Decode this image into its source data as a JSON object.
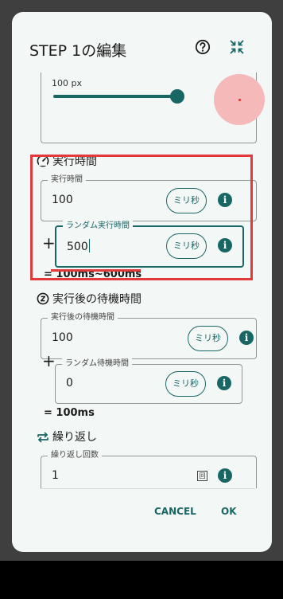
{
  "dialog": {
    "title": "STEP 1の編集",
    "help_icon": "help-circle-icon",
    "collapse_icon": "collapse-arrows-icon"
  },
  "size_slider": {
    "value_label": "100 px",
    "value_fraction": 0.92
  },
  "execution_time": {
    "section_title": "実行時間",
    "section_icon": "speedometer-icon",
    "field_label": "実行時間",
    "value": "100",
    "unit": "ミリ秒",
    "random_label": "ランダム実行時間",
    "random_value": "500",
    "random_unit": "ミリ秒",
    "plus": "+",
    "result": "=  100ms~600ms"
  },
  "wait_time": {
    "section_title": "実行後の待機時間",
    "section_icon": "sleep-z-icon",
    "field_label": "実行後の待機時間",
    "value": "100",
    "unit": "ミリ秒",
    "random_label": "ランダム待機時間",
    "random_value": "0",
    "random_unit": "ミリ秒",
    "plus": "+",
    "result": "=  100ms"
  },
  "repeat": {
    "section_title": "繰り返し",
    "section_icon": "repeat-icon",
    "field_label": "繰り返し回数",
    "value": "1",
    "unit": "回"
  },
  "info_glyph": "i",
  "buttons": {
    "cancel": "CANCEL",
    "ok": "OK"
  },
  "colors": {
    "accent": "#196765",
    "highlight": "#e23a3a",
    "dialog_bg": "#f3f7f6"
  }
}
